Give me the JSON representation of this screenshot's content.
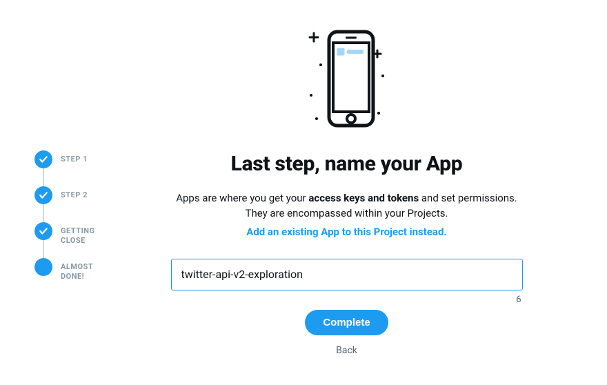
{
  "stepper": {
    "steps": [
      {
        "label": "STEP 1",
        "done": true
      },
      {
        "label": "STEP 2",
        "done": true
      },
      {
        "label": "GETTING CLOSE",
        "done": true
      },
      {
        "label": "ALMOST DONE!",
        "done": false
      }
    ]
  },
  "main": {
    "heading": "Last step, name your App",
    "description_pre": "Apps are where you get your ",
    "description_bold": "access keys and tokens",
    "description_post": " and set permissions. They are encompassed within your Projects.",
    "link_existing": "Add an existing App to this Project instead.",
    "input_value": "twitter-api-v2-exploration",
    "char_count": "6",
    "complete_label": "Complete",
    "back_label": "Back"
  }
}
